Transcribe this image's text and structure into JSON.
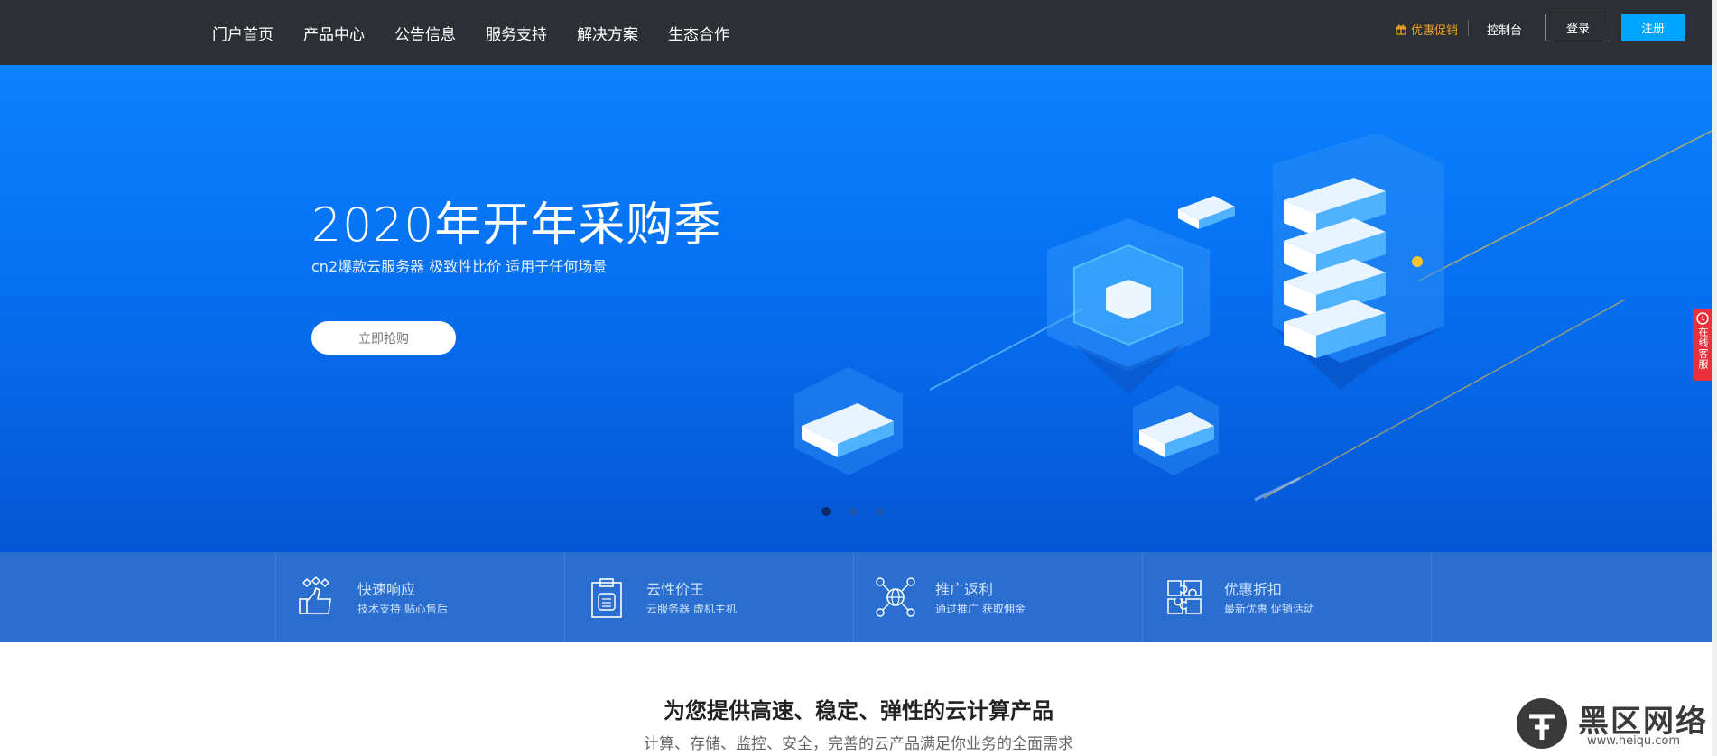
{
  "nav": {
    "items": [
      "门户首页",
      "产品中心",
      "公告信息",
      "服务支持",
      "解决方案",
      "生态合作"
    ]
  },
  "header_right": {
    "promo": "优惠促销",
    "console": "控制台",
    "login": "登录",
    "register": "注册"
  },
  "hero": {
    "title": "2020年开年采购季",
    "subtitle": "cn2爆款云服务器 极致性比价 适用于任何场景",
    "button": "立即抢购",
    "slides": 3,
    "active_slide": 1
  },
  "features": [
    {
      "title": "快速响应",
      "desc": "技术支持 贴心售后",
      "icon": "thumbs-up-hearts-icon"
    },
    {
      "title": "云性价王",
      "desc": "云服务器 虚机主机",
      "icon": "clipboard-server-icon"
    },
    {
      "title": "推广返利",
      "desc": "通过推广 获取佣金",
      "icon": "network-globe-icon"
    },
    {
      "title": "优惠折扣",
      "desc": "最新优惠 促销活动",
      "icon": "puzzle-icon"
    }
  ],
  "section": {
    "title": "为您提供高速、稳定、弹性的云计算产品",
    "subtitle": "计算、存储、监控、安全，完善的云产品满足你业务的全面需求"
  },
  "side_service": {
    "label": "在线客服"
  },
  "watermark": {
    "text": "黑区网络",
    "url": "www.heiqu.com"
  },
  "colors": {
    "topbar": "#2c3034",
    "accent": "#00a5ff",
    "promo": "#f0a020",
    "hero_start": "#0a82ff",
    "hero_end": "#0556d4",
    "feature_bar": "#2a6fd0",
    "side_service": "#e8313a"
  }
}
